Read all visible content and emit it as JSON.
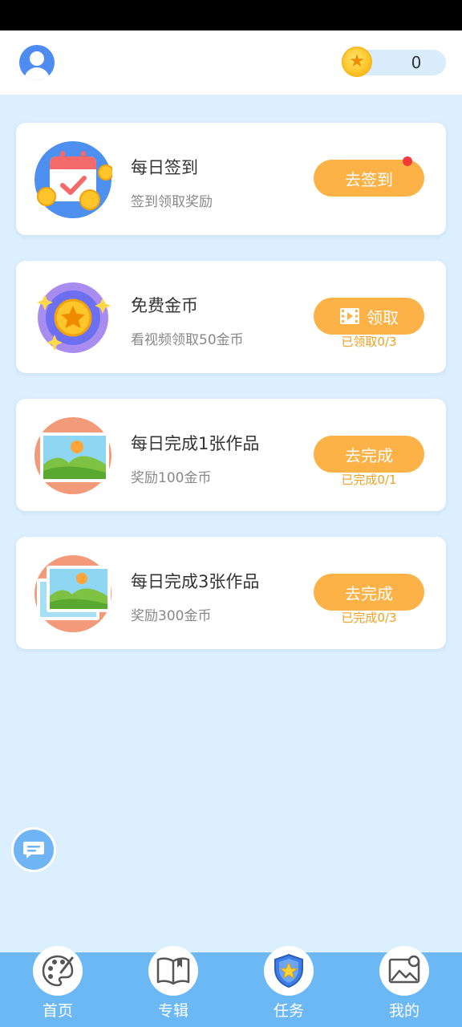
{
  "header": {
    "coin_count": "0"
  },
  "tasks": [
    {
      "title": "每日签到",
      "subtitle": "签到领取奖励",
      "button": "去签到",
      "progress": "",
      "icon": "calendar-icon",
      "has_red_dot": true
    },
    {
      "title": "免费金币",
      "subtitle": "看视频领取50金币",
      "button": "领取",
      "progress": "已领取0/3",
      "icon": "star-coin-icon",
      "has_video_icon": true
    },
    {
      "title": "每日完成1张作品",
      "subtitle": "奖励100金币",
      "button": "去完成",
      "progress": "已完成0/1",
      "icon": "landscape-picture-icon"
    },
    {
      "title": "每日完成3张作品",
      "subtitle": "奖励300金币",
      "button": "去完成",
      "progress": "已完成0/3",
      "icon": "stacked-pictures-icon"
    }
  ],
  "tabbar": {
    "items": [
      {
        "label": "首页",
        "icon": "palette-icon"
      },
      {
        "label": "专辑",
        "icon": "book-icon"
      },
      {
        "label": "任务",
        "icon": "shield-star-icon",
        "active": true
      },
      {
        "label": "我的",
        "icon": "gallery-icon"
      }
    ]
  },
  "colors": {
    "background": "#dcefff",
    "accent_button": "#fdb247",
    "progress_text": "#f0a020",
    "tabbar": "#6cb8f5",
    "badge_red": "#f23a3a"
  }
}
